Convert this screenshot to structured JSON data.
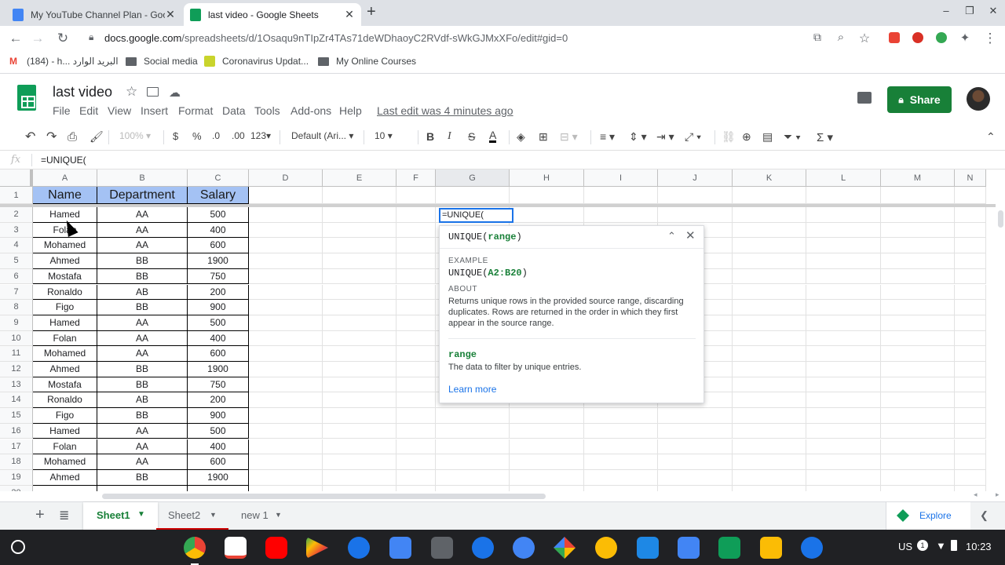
{
  "browser": {
    "tabs": [
      {
        "title": "My YouTube Channel Plan - Goo",
        "active": false
      },
      {
        "title": "last video - Google Sheets",
        "active": true
      }
    ],
    "url_domain": "docs.google.com",
    "url_rest": "/spreadsheets/d/1Osaqu9nTIpZr4TAs71deWDhaoyC2RVdf-sWkGJMxXFo/edit#gid=0",
    "bookmarks": [
      "(184) - h... البريد الوارد",
      "Social media",
      "Coronavirus Updat...",
      "My Online Courses"
    ]
  },
  "doc": {
    "title": "last video",
    "menus": [
      "File",
      "Edit",
      "View",
      "Insert",
      "Format",
      "Data",
      "Tools",
      "Add-ons",
      "Help"
    ],
    "last_edit": "Last edit was 4 minutes ago",
    "share_label": "Share"
  },
  "toolbar": {
    "zoom": "100%",
    "currency": "$",
    "percent": "%",
    "dec_less": ".0",
    "dec_more": ".00",
    "format_more": "123",
    "font": "Default (Ari...",
    "font_size": "10",
    "bold": "B",
    "italic": "I",
    "strike": "S",
    "text_color": "A",
    "sum": "Σ"
  },
  "formula_bar": {
    "fx": "fx",
    "value": "=UNIQUE("
  },
  "grid": {
    "columns": [
      "A",
      "B",
      "C",
      "D",
      "E",
      "F",
      "G",
      "H",
      "I",
      "J",
      "K",
      "L",
      "M",
      "N"
    ],
    "header_row": [
      "Name",
      "Department",
      "Salary"
    ],
    "rows": [
      [
        "Hamed",
        "AA",
        "500"
      ],
      [
        "Folan",
        "AA",
        "400"
      ],
      [
        "Mohamed",
        "AA",
        "600"
      ],
      [
        "Ahmed",
        "BB",
        "1900"
      ],
      [
        "Mostafa",
        "BB",
        "750"
      ],
      [
        "Ronaldo",
        "AB",
        "200"
      ],
      [
        "Figo",
        "BB",
        "900"
      ],
      [
        "Hamed",
        "AA",
        "500"
      ],
      [
        "Folan",
        "AA",
        "400"
      ],
      [
        "Mohamed",
        "AA",
        "600"
      ],
      [
        "Ahmed",
        "BB",
        "1900"
      ],
      [
        "Mostafa",
        "BB",
        "750"
      ],
      [
        "Ronaldo",
        "AB",
        "200"
      ],
      [
        "Figo",
        "BB",
        "900"
      ],
      [
        "Hamed",
        "AA",
        "500"
      ],
      [
        "Folan",
        "AA",
        "400"
      ],
      [
        "Mohamed",
        "AA",
        "600"
      ],
      [
        "Ahmed",
        "BB",
        "1900"
      ]
    ],
    "active_cell": "=UNIQUE("
  },
  "help": {
    "signature_fn": "UNIQUE(",
    "signature_arg": "range",
    "signature_close": ")",
    "example_label": "EXAMPLE",
    "example_fn": "UNIQUE(",
    "example_arg": "A2:B20",
    "example_close": ")",
    "about_label": "ABOUT",
    "about_text": "Returns unique rows in the provided source range, discarding duplicates. Rows are returned in the order in which they first appear in the source range.",
    "param_name": "range",
    "param_desc": "The data to filter by unique entries.",
    "learn_more": "Learn more"
  },
  "sheets": {
    "tabs": [
      "Sheet1",
      "Sheet2",
      "new 1"
    ],
    "explore": "Explore"
  },
  "shelf": {
    "status_locale": "US",
    "status_badge": "1",
    "time": "10:23"
  },
  "colors": {
    "accent": "#1a73e8",
    "header_fill": "#a4c2f4",
    "share": "#188038",
    "sheet_tab_active": "#188038"
  }
}
